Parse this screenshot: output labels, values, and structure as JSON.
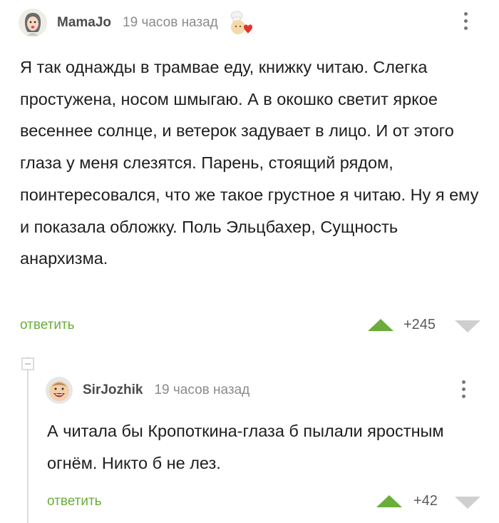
{
  "comments": [
    {
      "username": "MamaJo",
      "time": "19 часов назад",
      "text": "Я так однажды в трамвае еду, книжку читаю. Слегка простужена, носом шмыгаю. А в окошко светит яркое весеннее солнце, и ветерок задувает в лицо. И от этого глаза у меня слезятся. Парень, стоящий рядом, поинтересовался, что же такое грустное я читаю. Ну я ему и показала обложку. Поль Эльцбахер, Сущность анархизма.",
      "reply_label": "ответить",
      "rating": "+245"
    },
    {
      "username": "SirJozhik",
      "time": "19 часов назад",
      "text": "А читала бы Кропоткина-глаза б пылали яростным огнём. Никто б не лез.",
      "reply_label": "ответить",
      "rating": "+42"
    }
  ],
  "colors": {
    "accent": "#6aad3a",
    "downvote": "#cfcfcf",
    "thread_line": "#dcdcdc"
  },
  "icons": {
    "avatar_1": "woman-avatar-icon",
    "badge_1": "chef-heart-badge-icon",
    "avatar_2": "baby-avatar-icon",
    "menu": "vertical-dots-icon",
    "upvote": "triangle-up-icon",
    "downvote": "triangle-down-icon",
    "collapse": "minus-square-icon"
  }
}
